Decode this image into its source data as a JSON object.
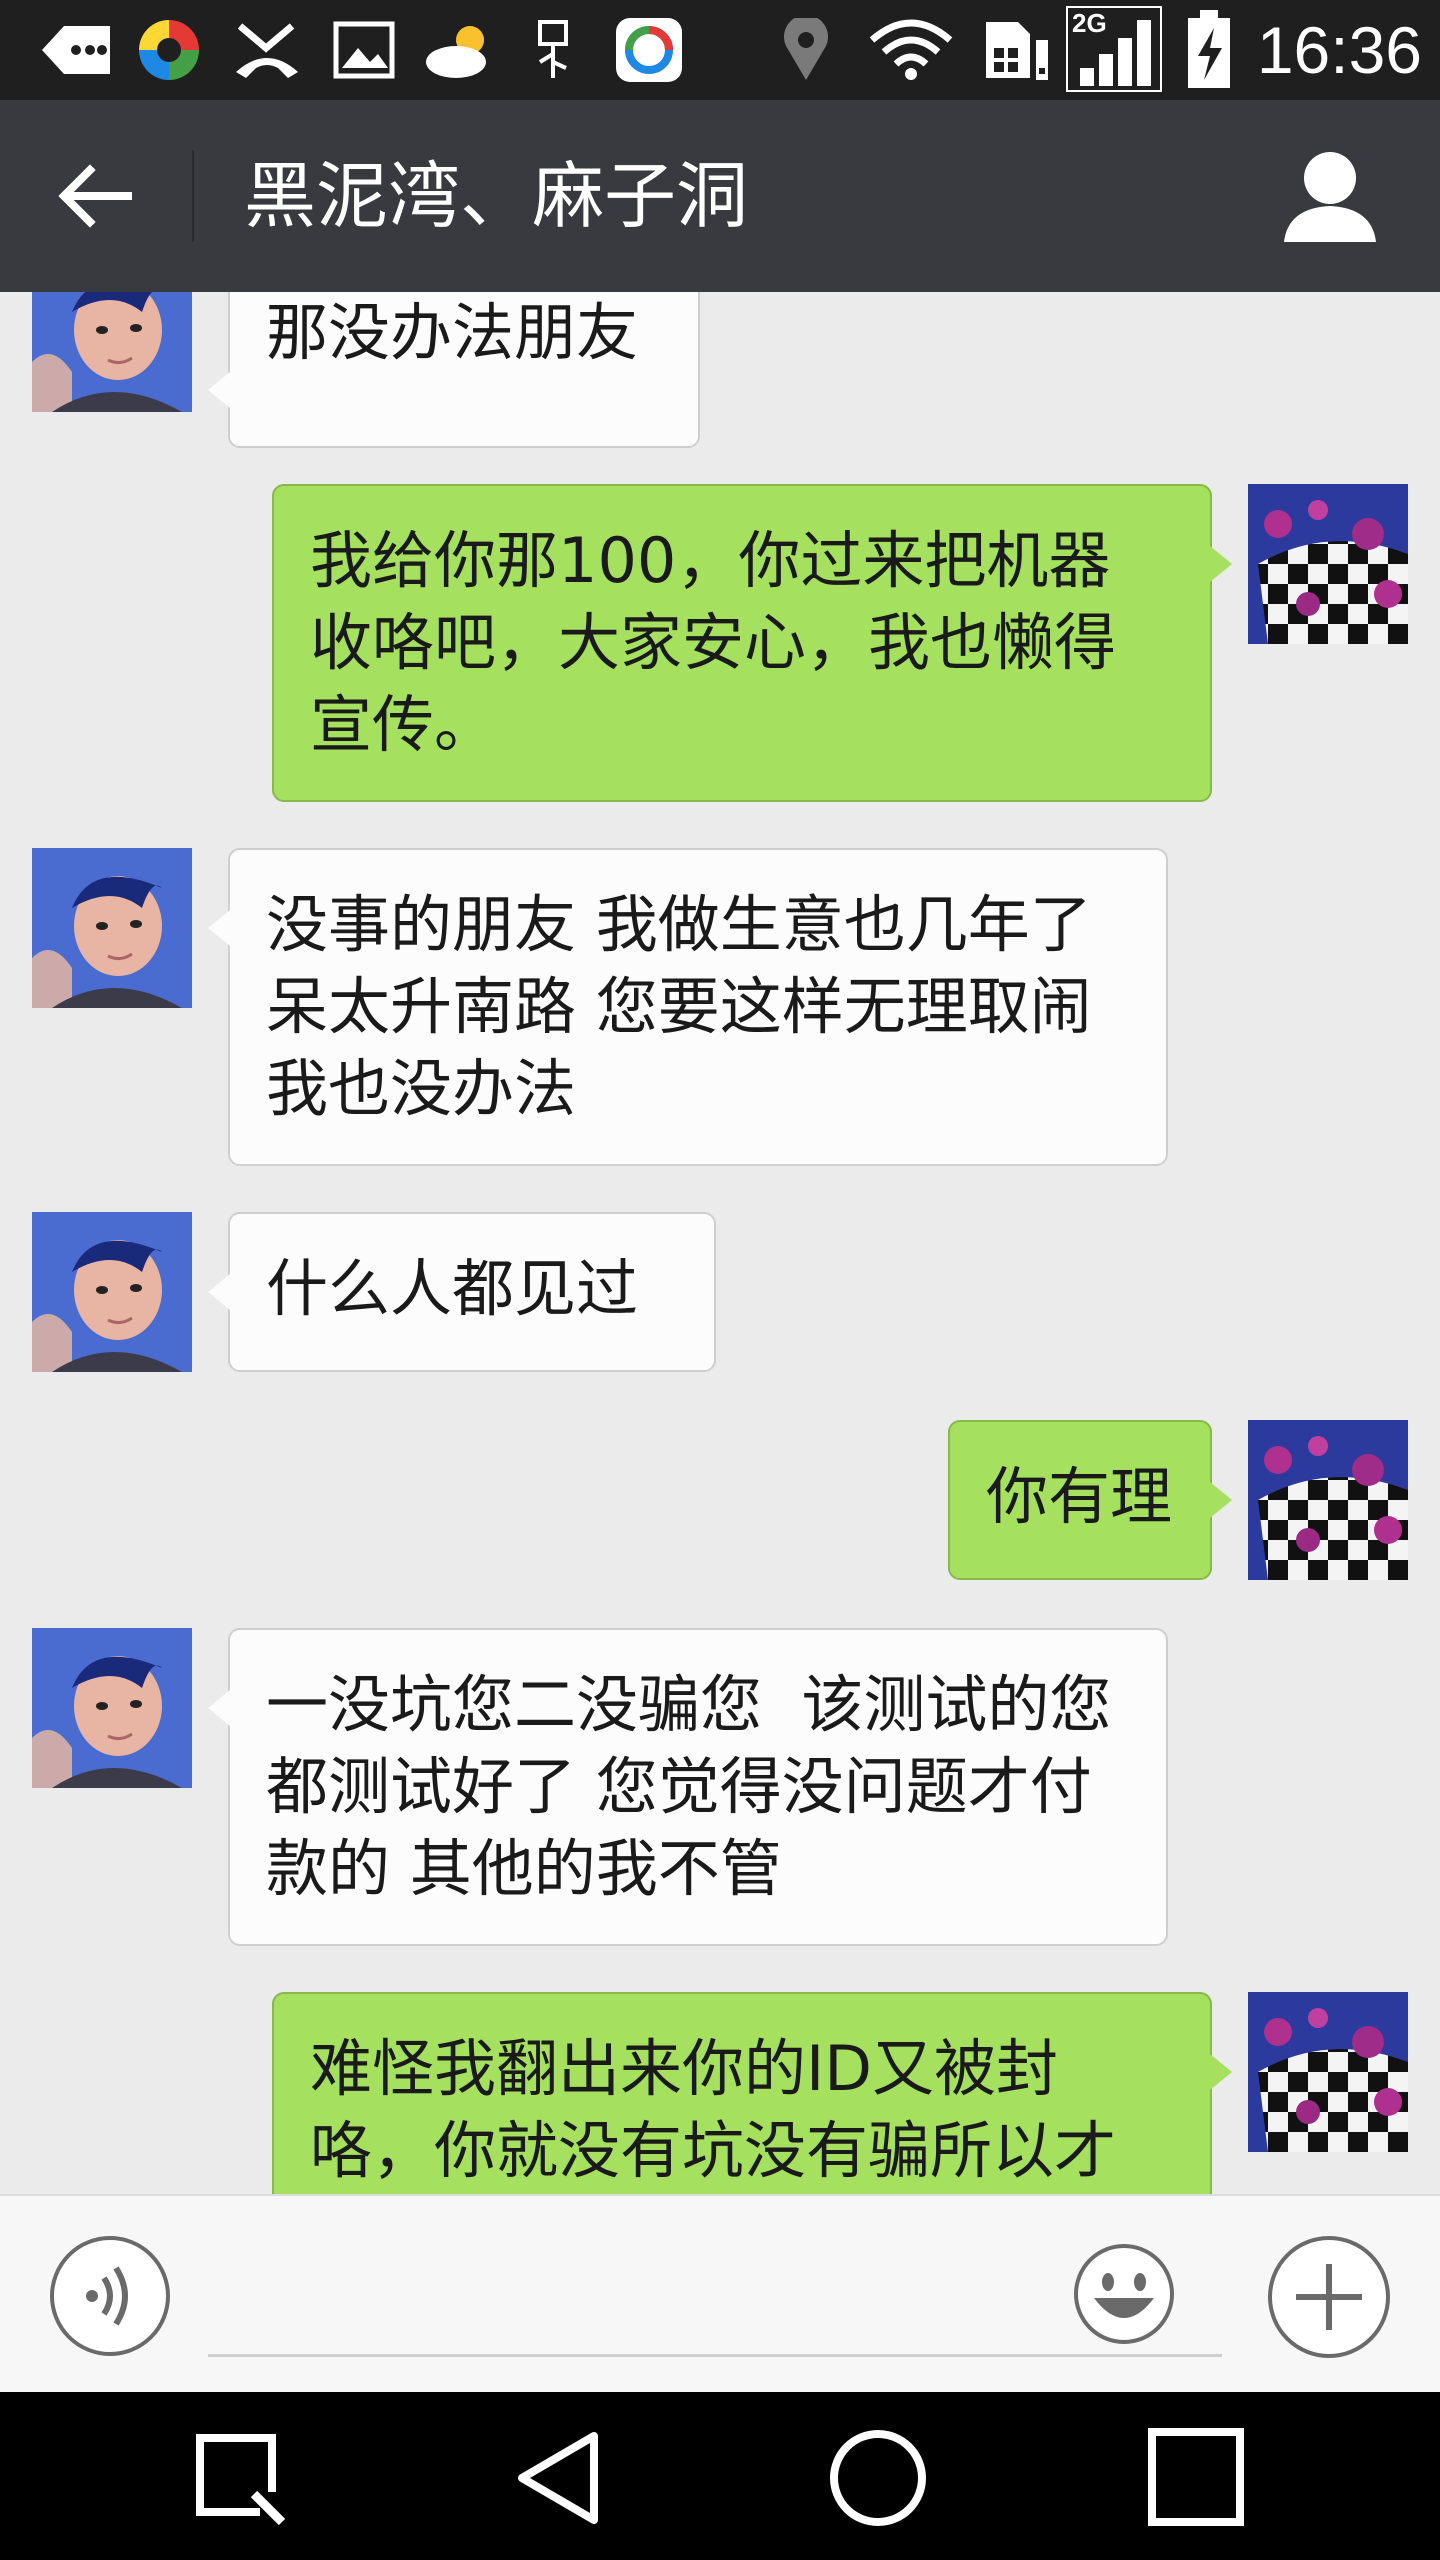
{
  "status_bar": {
    "time": "16:36",
    "network": "2G",
    "icons": [
      "message-back-icon",
      "colorful-app-icon",
      "missed-call-icon",
      "image-icon",
      "weather-cloud-sun-icon",
      "usb-icon",
      "tencent-app-icon",
      "location-icon",
      "wifi-icon",
      "sim-alert-icon",
      "signal-icon",
      "battery-charging-icon"
    ]
  },
  "header": {
    "title": "黑泥湾、麻子洞",
    "back_icon": "arrow-left-icon",
    "profile_icon": "person-icon"
  },
  "messages": [
    {
      "side": "in",
      "lines": [
        "那没办法朋友"
      ]
    },
    {
      "side": "out",
      "lines": [
        "我给你那100，你过来把机器",
        "收咯吧，大家安心，我也懒得",
        "宣传。"
      ]
    },
    {
      "side": "in",
      "lines": [
        "没事的朋友 我做生意也几年了",
        "呆太升南路 您要这样无理取闹",
        "我也没办法"
      ]
    },
    {
      "side": "in",
      "lines": [
        "什么人都见过"
      ]
    },
    {
      "side": "out",
      "lines": [
        "你有理"
      ]
    },
    {
      "side": "in",
      "lines": [
        "一没坑您二没骗您  该测试的您",
        "都测试好了 您觉得没问题才付",
        "款的 其他的我不管"
      ]
    },
    {
      "side": "out",
      "lines": [
        "难怪我翻出来你的ID又被封",
        "咯，你就没有坑没有骗所以才"
      ]
    }
  ],
  "input_bar": {
    "voice_icon": "voice-icon",
    "text_value": "",
    "emoji_icon": "smiley-icon",
    "plus_icon": "plus-icon"
  },
  "nav_bar": {
    "icons": [
      "search-square-icon",
      "back-triangle-icon",
      "home-circle-icon",
      "recents-square-icon"
    ]
  },
  "colors": {
    "status_bar": "#1f1f1f",
    "action_bar": "#393a3f",
    "chat_bg": "#ebebeb",
    "bubble_out": "#a6e05f",
    "bubble_in": "#fcfcfc"
  }
}
